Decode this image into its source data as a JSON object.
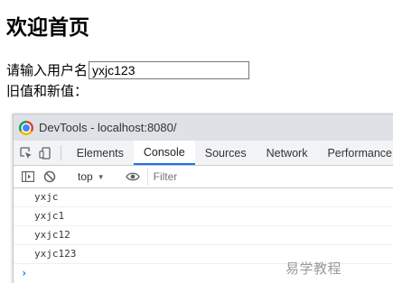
{
  "page": {
    "heading": "欢迎首页",
    "username_label": "请输入用户名",
    "username_value": "yxjc123",
    "history_label": "旧值和新值："
  },
  "devtools": {
    "window_title": "DevTools - localhost:8080/",
    "tabs": [
      {
        "label": "Elements",
        "active": false
      },
      {
        "label": "Console",
        "active": true
      },
      {
        "label": "Sources",
        "active": false
      },
      {
        "label": "Network",
        "active": false
      },
      {
        "label": "Performance",
        "active": false
      }
    ],
    "context": "top",
    "filter_placeholder": "Filter",
    "logs": [
      "yxjc",
      "yxjc1",
      "yxjc12",
      "yxjc123"
    ],
    "prompt": "›"
  },
  "watermark": "易学教程",
  "colors": {
    "accent": "#1a73e8",
    "titlebar_bg": "#dee1e6",
    "toolbar_bg": "#f1f3f4"
  }
}
